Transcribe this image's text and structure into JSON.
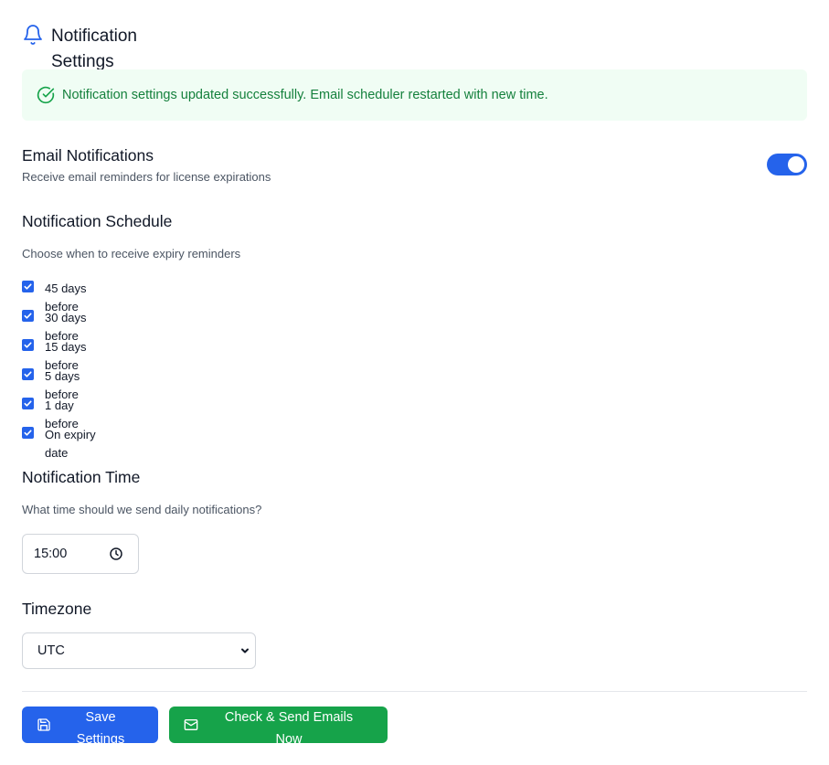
{
  "header": {
    "title": "Notification Settings",
    "icon": "bell-icon"
  },
  "alert": {
    "icon": "check-circle-icon",
    "message": "Notification settings updated successfully. Email scheduler restarted with new time."
  },
  "email": {
    "title": "Email Notifications",
    "description": "Receive email reminders for license expirations",
    "enabled": true
  },
  "schedule": {
    "title": "Notification Schedule",
    "description": "Choose when to receive expiry reminders",
    "options": [
      {
        "label": "45 days before",
        "checked": true
      },
      {
        "label": "30 days before",
        "checked": true
      },
      {
        "label": "15 days before",
        "checked": true
      },
      {
        "label": "5 days before",
        "checked": true
      },
      {
        "label": "1 day before",
        "checked": true
      },
      {
        "label": "On expiry date",
        "checked": true
      }
    ]
  },
  "time": {
    "title": "Notification Time",
    "description": "What time should we send daily notifications?",
    "value": "15:00",
    "icon": "clock-icon"
  },
  "timezone": {
    "title": "Timezone",
    "selected": "UTC"
  },
  "actions": {
    "save_label": "Save Settings",
    "check_label": "Check & Send Emails Now"
  },
  "colors": {
    "primary": "#2563eb",
    "success": "#16a34a",
    "success_text": "#15803d",
    "success_bg": "#f0fdf4"
  }
}
